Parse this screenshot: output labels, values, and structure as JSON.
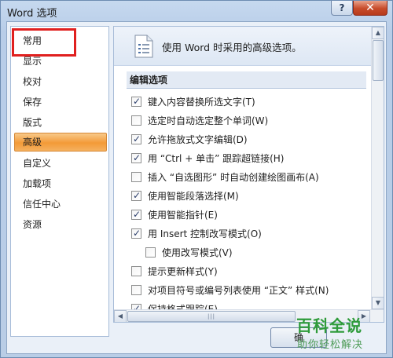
{
  "window": {
    "title": "Word 选项",
    "help_glyph": "?",
    "close_glyph": "✕"
  },
  "sidebar": {
    "items": [
      {
        "label": "常用",
        "selected": false
      },
      {
        "label": "显示",
        "selected": false
      },
      {
        "label": "校对",
        "selected": false
      },
      {
        "label": "保存",
        "selected": false
      },
      {
        "label": "版式",
        "selected": false
      },
      {
        "label": "高级",
        "selected": true
      },
      {
        "label": "自定义",
        "selected": false
      },
      {
        "label": "加载项",
        "selected": false
      },
      {
        "label": "信任中心",
        "selected": false
      },
      {
        "label": "资源",
        "selected": false
      }
    ]
  },
  "main": {
    "header_text": "使用 Word 时采用的高级选项。",
    "header_icon": "document-settings-icon",
    "section_title": "编辑选项",
    "options": [
      {
        "label": "键入内容替换所选文字(T)",
        "checked": true,
        "indent": false
      },
      {
        "label": "选定时自动选定整个单词(W)",
        "checked": false,
        "indent": false
      },
      {
        "label": "允许拖放式文字编辑(D)",
        "checked": true,
        "indent": false
      },
      {
        "label": "用 “Ctrl + 单击” 跟踪超链接(H)",
        "checked": true,
        "indent": false
      },
      {
        "label": "插入 “自选图形” 时自动创建绘图画布(A)",
        "checked": false,
        "indent": false
      },
      {
        "label": "使用智能段落选择(M)",
        "checked": true,
        "indent": false
      },
      {
        "label": "使用智能指针(E)",
        "checked": true,
        "indent": false
      },
      {
        "label": "用 Insert 控制改写模式(O)",
        "checked": true,
        "indent": false
      },
      {
        "label": "使用改写模式(V)",
        "checked": false,
        "indent": true
      },
      {
        "label": "提示更新样式(Y)",
        "checked": false,
        "indent": false
      },
      {
        "label": "对项目符号或编号列表使用 “正文” 样式(N)",
        "checked": false,
        "indent": false
      },
      {
        "label": "保持格式跟踪(E)",
        "checked": true,
        "indent": false
      }
    ]
  },
  "buttons": {
    "ok_partial": "确"
  },
  "scrollbar": {
    "thumb_grip": "|||"
  },
  "watermark": {
    "title": "百科全说",
    "subtitle": "助你轻松解决"
  },
  "colors": {
    "selected_nav": "#f39a37",
    "annotation_red": "#e0201f",
    "watermark_green": "#2e9b3a"
  }
}
